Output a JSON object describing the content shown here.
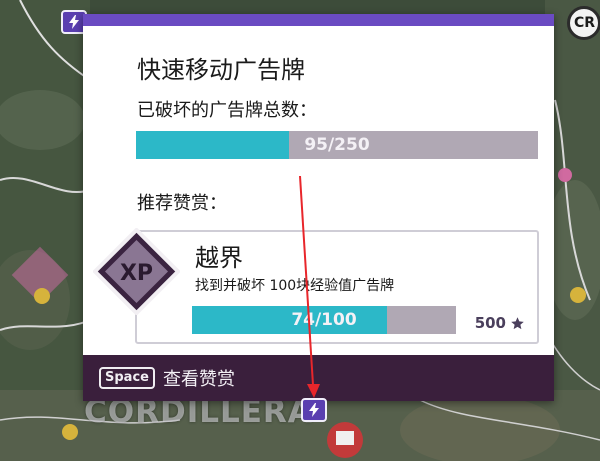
{
  "map": {
    "region_label": "CORDILLERA",
    "marker_badge": "CR"
  },
  "panel": {
    "title": "快速移动广告牌",
    "destroyed_label": "已破坏的广告牌总数：",
    "destroyed_progress": {
      "current": 95,
      "total": 250,
      "text": "95/250"
    },
    "reward_section_label": "推荐赞赏：",
    "reward": {
      "icon_text": "XP",
      "name": "越界",
      "description": "找到并破坏 100块经验值广告牌",
      "progress": {
        "current": 74,
        "total": 100,
        "text": "74/100"
      },
      "points": "500"
    },
    "footer": {
      "key": "Space",
      "action": "查看赞赏"
    }
  },
  "colors": {
    "accent_purple": "#6a4bc2",
    "progress_fill": "#2cb8c8",
    "progress_track": "#b0a8b4",
    "footer_bg": "#3a1f3c",
    "arrow_red": "#e8262b"
  },
  "icons": [
    "lightning-bolt-icon",
    "xp-diamond-icon",
    "star-icon",
    "cr-badge-icon"
  ]
}
